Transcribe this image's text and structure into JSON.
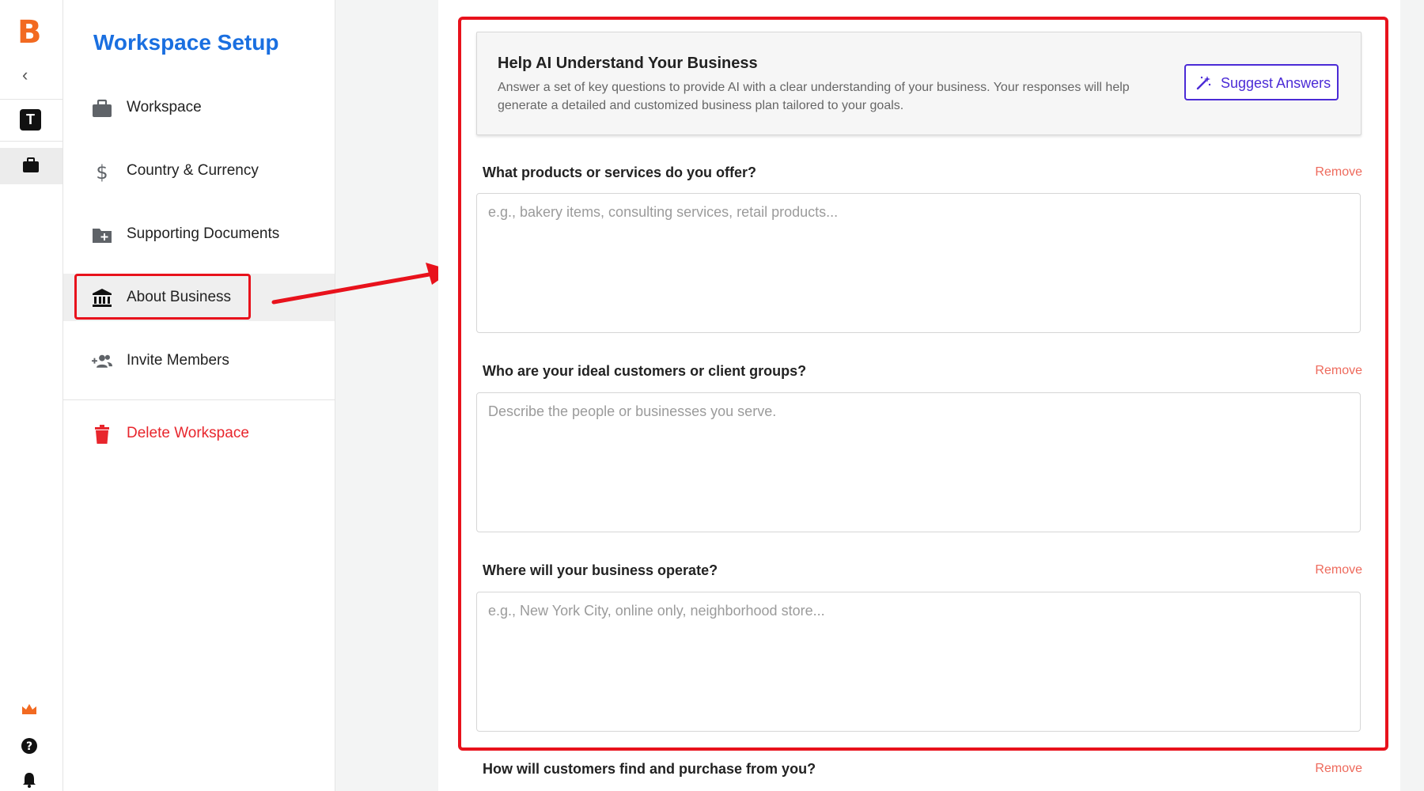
{
  "rail": {
    "logo": "B",
    "collapse_glyph": "‹",
    "workspace_initial": "T",
    "icons": [
      "collapse-icon",
      "workspace-avatar",
      "briefcase-icon",
      "crown-icon",
      "help-icon",
      "bell-icon"
    ]
  },
  "sidebar": {
    "title": "Workspace Setup",
    "items": [
      {
        "label": "Workspace",
        "icon": "briefcase-icon"
      },
      {
        "label": "Country & Currency",
        "icon": "dollar-icon"
      },
      {
        "label": "Supporting Documents",
        "icon": "folder-plus-icon"
      },
      {
        "label": "About Business",
        "icon": "bank-icon",
        "selected": true
      },
      {
        "label": "Invite Members",
        "icon": "add-group-icon"
      }
    ],
    "delete_label": "Delete Workspace"
  },
  "main": {
    "card": {
      "title": "Help AI Understand Your Business",
      "description": "Answer a set of key questions to provide AI with a clear understanding of your business. Your responses will help generate a detailed and customized business plan tailored to your goals.",
      "suggest_label": "Suggest Answers"
    },
    "questions": [
      {
        "label": "What products or services do you offer?",
        "placeholder": "e.g., bakery items, consulting services, retail products...",
        "remove": "Remove"
      },
      {
        "label": "Who are your ideal customers or client groups?",
        "placeholder": "Describe the people or businesses you serve.",
        "remove": "Remove"
      },
      {
        "label": "Where will your business operate?",
        "placeholder": "e.g., New York City, online only, neighborhood store...",
        "remove": "Remove"
      },
      {
        "label": "How will customers find and purchase from you?",
        "placeholder": "",
        "remove": "Remove"
      }
    ]
  },
  "colors": {
    "accent_blue": "#1a6fe0",
    "brand_orange": "#f26a21",
    "danger_red": "#e8262d",
    "suggest_purple": "#4b2bd6",
    "annotation_red": "#e8121c"
  }
}
